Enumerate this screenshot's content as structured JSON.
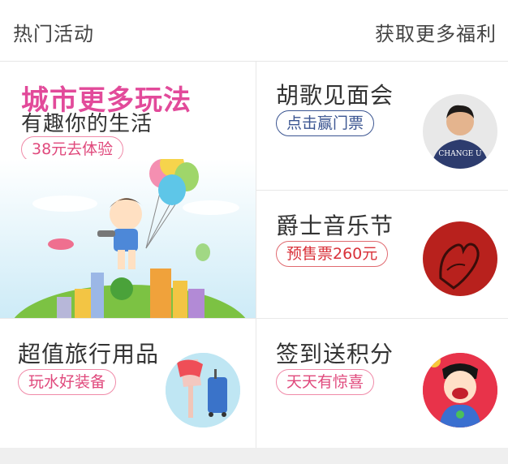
{
  "header": {
    "title": "热门活动",
    "more_link": "获取更多福利"
  },
  "featured": {
    "headline": "城市更多玩法",
    "subheadline": "有趣你的生活",
    "cta": "38元去体验",
    "image_icon": "boy-with-balloons-illustration"
  },
  "cards": [
    {
      "title": "胡歌见面会",
      "cta": "点击赢门票",
      "image_icon": "person-portrait",
      "image_text": "CHANGE U"
    },
    {
      "title": "爵士音乐节",
      "cta": "预售票260元",
      "image_icon": "hands-heart-gesture"
    },
    {
      "title": "超值旅行用品",
      "cta": "玩水好装备",
      "image_icon": "traveler-with-suitcase"
    },
    {
      "title": "签到送积分",
      "cta": "天天有惊喜",
      "image_icon": "superhero-cartoon"
    }
  ],
  "colors": {
    "featured_headline": "#e24a9a",
    "pink_pill": "#e0497c",
    "blue_pill": "#3b5591",
    "red_pill": "#d9323a"
  }
}
